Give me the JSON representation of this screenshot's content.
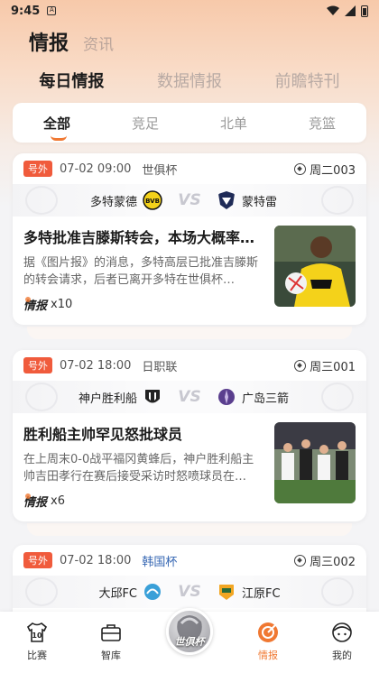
{
  "status_bar": {
    "time": "9:45",
    "notif": "A"
  },
  "top_tabs": [
    {
      "label": "情报",
      "active": true
    },
    {
      "label": "资讯",
      "active": false
    }
  ],
  "sub_tabs": [
    {
      "label": "每日情报",
      "active": true
    },
    {
      "label": "数据情报",
      "active": false
    },
    {
      "label": "前瞻特刊",
      "active": false
    }
  ],
  "filters": [
    {
      "label": "全部",
      "active": true
    },
    {
      "label": "竞足",
      "active": false
    },
    {
      "label": "北单",
      "active": false
    },
    {
      "label": "竞篮",
      "active": false
    }
  ],
  "cards": [
    {
      "badge": "号外",
      "datetime": "07-02 09:00",
      "league": "世俱杯",
      "match_no": "周二003",
      "home": "多特蒙德",
      "away": "蒙特雷",
      "vs": "VS",
      "headline": "多特批准吉滕斯转会，本场大概率不…",
      "summary": "据《图片报》的消息，多特高层已批准吉滕斯的转会请求，后者已离开多特在世俱杯…",
      "intel_label": "情报",
      "intel_count": "x10",
      "colors": {
        "home": "#f4d21a",
        "away": "#1f2b57"
      }
    },
    {
      "badge": "号外",
      "datetime": "07-02 18:00",
      "league": "日职联",
      "match_no": "周三001",
      "home": "神户胜利船",
      "away": "广岛三箭",
      "vs": "VS",
      "headline": "胜利船主帅罕见怒批球员",
      "summary": "在上周末0-0战平福冈黄蜂后，神户胜利船主帅吉田孝行在赛后接受采访时怒喷球员在…",
      "intel_label": "情报",
      "intel_count": "x6",
      "colors": {
        "home": "#222222",
        "away": "#5a3e8e"
      }
    },
    {
      "badge": "号外",
      "datetime": "07-02 18:00",
      "league": "韩国杯",
      "match_no": "周三002",
      "home": "大邱FC",
      "away": "江原FC",
      "vs": "VS",
      "colors": {
        "home": "#3aa0d8",
        "away": "#f2a623"
      }
    }
  ],
  "tabbar": [
    {
      "label": "比赛",
      "icon": "jersey-icon",
      "active": false
    },
    {
      "label": "智库",
      "icon": "briefcase-icon",
      "active": false
    },
    {
      "label": "世俱杯",
      "icon": "trophy-icon",
      "active": false
    },
    {
      "label": "情报",
      "icon": "target-icon",
      "active": true
    },
    {
      "label": "我的",
      "icon": "profile-icon",
      "active": false
    }
  ],
  "jersey_number": "10",
  "accent": "#f07832"
}
